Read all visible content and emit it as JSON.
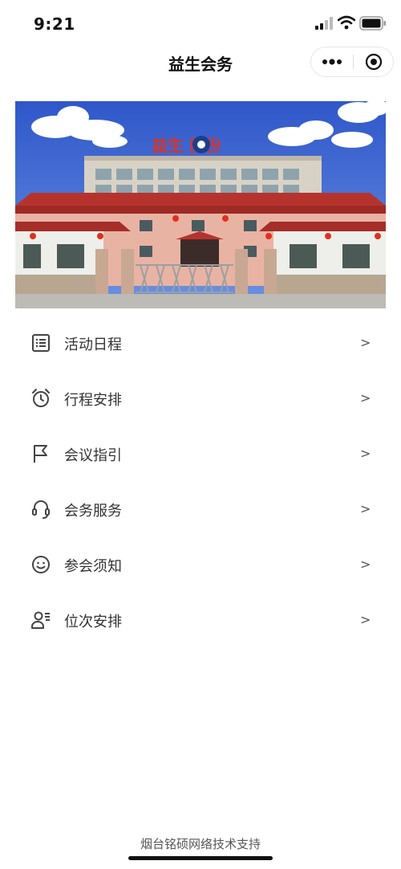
{
  "status": {
    "time": "9:21"
  },
  "nav": {
    "title": "益生会务"
  },
  "banner": {
    "sign_text": "益生 股份"
  },
  "menu": [
    {
      "label": "活动日程",
      "icon": "list-icon",
      "arrow": ">"
    },
    {
      "label": "行程安排",
      "icon": "alarm-clock-icon",
      "arrow": ">"
    },
    {
      "label": "会议指引",
      "icon": "flag-icon",
      "arrow": ">"
    },
    {
      "label": "会务服务",
      "icon": "headset-icon",
      "arrow": ">"
    },
    {
      "label": "参会须知",
      "icon": "smile-icon",
      "arrow": ">"
    },
    {
      "label": "位次安排",
      "icon": "person-list-icon",
      "arrow": ">"
    }
  ],
  "footer": {
    "text": "烟台铭硕网络技术支持"
  }
}
